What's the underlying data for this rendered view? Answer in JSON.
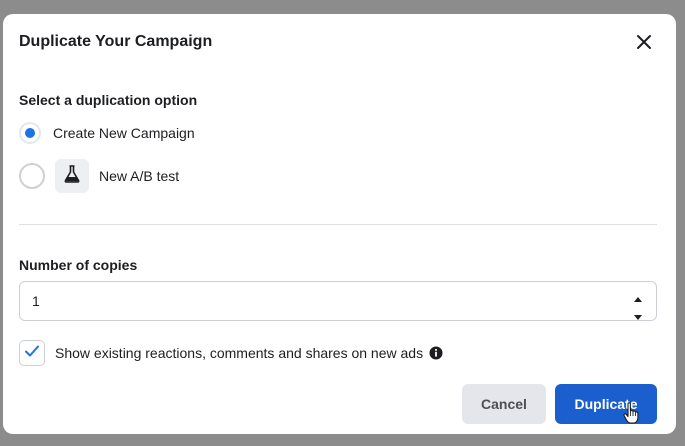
{
  "dialog": {
    "title": "Duplicate Your Campaign",
    "close_icon": "close-icon"
  },
  "duplication": {
    "label": "Select a duplication option",
    "options": [
      {
        "label": "Create New Campaign",
        "selected": true
      },
      {
        "label": "New A/B test",
        "selected": false,
        "icon": "flask-icon"
      }
    ]
  },
  "copies": {
    "label": "Number of copies",
    "value": "1"
  },
  "reactions": {
    "checked": true,
    "label": "Show existing reactions, comments and shares on new ads",
    "info_icon": "info-icon"
  },
  "buttons": {
    "cancel": "Cancel",
    "duplicate": "Duplicate"
  },
  "colors": {
    "primary": "#1b5fce",
    "radio_selected": "#1b74e4",
    "checkmark": "#1b74e4",
    "overlay": "#8c8c8c"
  }
}
